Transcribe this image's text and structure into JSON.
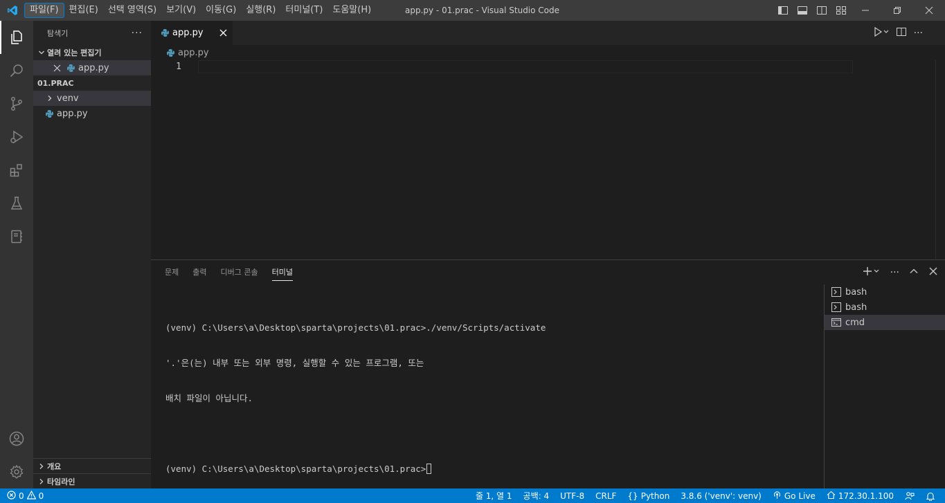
{
  "window": {
    "title": "app.py - 01.prac - Visual Studio Code"
  },
  "menu": [
    "파일(F)",
    "편집(E)",
    "선택 영역(S)",
    "보기(V)",
    "이동(G)",
    "실행(R)",
    "터미널(T)",
    "도움말(H)"
  ],
  "activity": [
    "explorer-icon",
    "search-icon",
    "source-control-icon",
    "run-debug-icon",
    "extensions-icon",
    "testing-icon",
    "notebook-icon",
    "account-icon",
    "settings-gear-icon"
  ],
  "sidebar": {
    "title": "탐색기",
    "more": "···",
    "open_editors": {
      "label": "열려 있는 편집기",
      "items": [
        "app.py"
      ]
    },
    "folder": {
      "label": "01.PRAC",
      "items": [
        "venv",
        "app.py"
      ]
    },
    "outline": "개요",
    "timeline": "타임라인"
  },
  "editor": {
    "tab_label": "app.py",
    "breadcrumb": "app.py",
    "line_number": "1"
  },
  "panel": {
    "tabs": [
      "문제",
      "출력",
      "디버그 콘솔",
      "터미널"
    ],
    "active_tab": "터미널",
    "terminal_lines": [
      "(venv) C:\\Users\\a\\Desktop\\sparta\\projects\\01.prac>./venv/Scripts/activate",
      "'.'은(는) 내부 또는 외부 명령, 실행할 수 있는 프로그램, 또는",
      "배치 파일이 아닙니다.",
      "",
      "(venv) C:\\Users\\a\\Desktop\\sparta\\projects\\01.prac>"
    ],
    "terminals": [
      "bash",
      "bash",
      "cmd"
    ]
  },
  "status": {
    "errors": "0",
    "warnings": "0",
    "position": "줄 1, 열 1",
    "spaces": "공백: 4",
    "encoding": "UTF-8",
    "eol": "CRLF",
    "language": "Python",
    "interpreter": "3.8.6 ('venv': venv)",
    "golive": "Go Live",
    "ip": "172.30.1.100"
  },
  "colors": {
    "statusbar": "#007acc",
    "titlebar": "#3c3c3c",
    "activitybar": "#333333",
    "sidebar": "#252526",
    "editor": "#1e1e1e"
  }
}
